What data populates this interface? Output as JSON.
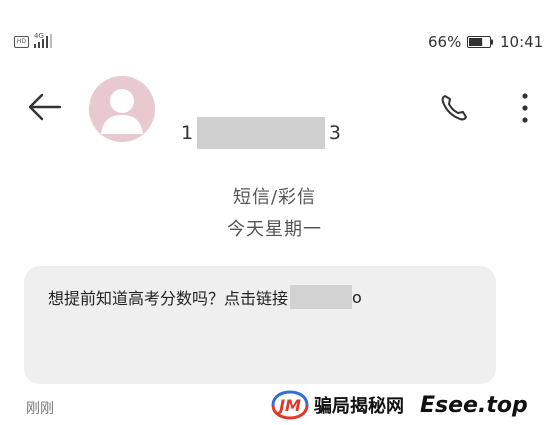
{
  "status_bar": {
    "hd_label": "HD",
    "network_label": "4G",
    "battery_percent": "66%",
    "battery_level": 0.66,
    "time": "10:41"
  },
  "header": {
    "contact_number_first": "1",
    "contact_number_last": "3",
    "back_icon": "arrow-left-icon",
    "call_icon": "phone-icon",
    "more_icon": "more-vertical-icon",
    "avatar_icon": "person-icon",
    "avatar_color": "#e8c9cf"
  },
  "conversation": {
    "type_label": "短信/彩信",
    "date_label": "今天星期一"
  },
  "message": {
    "text": "想提前知道高考分数吗？点击链接",
    "link_tail": "o",
    "timestamp": "刚刚",
    "bubble_color": "#efefef"
  },
  "watermark": {
    "logo_text": "JM",
    "cn_text": "骗局揭秘网",
    "en_text": "Esee.top"
  }
}
